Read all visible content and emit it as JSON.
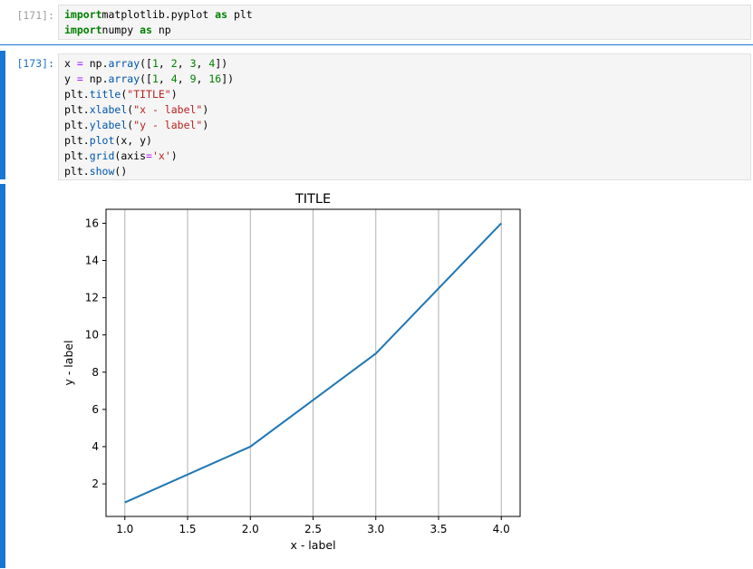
{
  "cells": [
    {
      "prompt": "[171]:",
      "code": [
        [
          [
            "kw",
            "import"
          ],
          [
            "",
            "matplotlib.pyplot "
          ],
          [
            "kw",
            "as"
          ],
          [
            "",
            " plt"
          ]
        ],
        [
          [
            "kw",
            "import"
          ],
          [
            "",
            "",
            " "
          ],
          [
            "",
            "numpy "
          ],
          [
            "kw",
            "as"
          ],
          [
            "",
            " np"
          ]
        ]
      ]
    },
    {
      "prompt": "[173]:",
      "code": [
        [
          [
            "",
            "x "
          ],
          [
            "op",
            "="
          ],
          [
            "",
            " np."
          ],
          [
            "fn",
            "array"
          ],
          [
            "",
            "(["
          ],
          [
            "num",
            "1"
          ],
          [
            "",
            ", "
          ],
          [
            "num",
            "2"
          ],
          [
            "",
            ", "
          ],
          [
            "num",
            "3"
          ],
          [
            "",
            ", "
          ],
          [
            "num",
            "4"
          ],
          [
            "",
            "])"
          ]
        ],
        [
          [
            "",
            "y "
          ],
          [
            "op",
            "="
          ],
          [
            "",
            " np."
          ],
          [
            "fn",
            "array"
          ],
          [
            "",
            "(["
          ],
          [
            "num",
            "1"
          ],
          [
            "",
            ", "
          ],
          [
            "num",
            "4"
          ],
          [
            "",
            ", "
          ],
          [
            "num",
            "9"
          ],
          [
            "",
            ", "
          ],
          [
            "num",
            "16"
          ],
          [
            "",
            "])"
          ]
        ],
        [
          [
            "",
            "plt."
          ],
          [
            "fn",
            "title"
          ],
          [
            "",
            "("
          ],
          [
            "str",
            "\"TITLE\""
          ],
          [
            "",
            ")"
          ]
        ],
        [
          [
            "",
            "plt."
          ],
          [
            "fn",
            "xlabel"
          ],
          [
            "",
            "("
          ],
          [
            "str",
            "\"x - label\""
          ],
          [
            "",
            ")"
          ]
        ],
        [
          [
            "",
            "plt."
          ],
          [
            "fn",
            "ylabel"
          ],
          [
            "",
            "("
          ],
          [
            "str",
            "\"y - label\""
          ],
          [
            "",
            ")"
          ]
        ],
        [
          [
            "",
            "plt."
          ],
          [
            "fn",
            "plot"
          ],
          [
            "",
            "(x, y)"
          ]
        ],
        [
          [
            "",
            "plt."
          ],
          [
            "fn",
            "grid"
          ],
          [
            "",
            "(axis"
          ],
          [
            "op",
            "="
          ],
          [
            "str",
            "'x'"
          ],
          [
            "",
            ")"
          ]
        ],
        [
          [
            "",
            "plt."
          ],
          [
            "fn",
            "show"
          ],
          [
            "",
            "()"
          ]
        ]
      ]
    }
  ],
  "chart_data": {
    "type": "line",
    "title": "TITLE",
    "xlabel": "x - label",
    "ylabel": "y - label",
    "x": [
      1,
      2,
      3,
      4
    ],
    "series": [
      {
        "values": [
          1,
          4,
          9,
          16
        ],
        "color": "#1f77b4"
      }
    ],
    "xlim": [
      0.85,
      4.15
    ],
    "ylim": [
      0.25,
      16.75
    ],
    "xticks": [
      1.0,
      1.5,
      2.0,
      2.5,
      3.0,
      3.5,
      4.0
    ],
    "xtick_labels": [
      "1.0",
      "1.5",
      "2.0",
      "2.5",
      "3.0",
      "3.5",
      "4.0"
    ],
    "yticks": [
      2,
      4,
      6,
      8,
      10,
      12,
      14,
      16
    ],
    "ytick_labels": [
      "2",
      "4",
      "6",
      "8",
      "10",
      "12",
      "14",
      "16"
    ],
    "grid": "x",
    "grid_color": "#b0b0b0"
  }
}
